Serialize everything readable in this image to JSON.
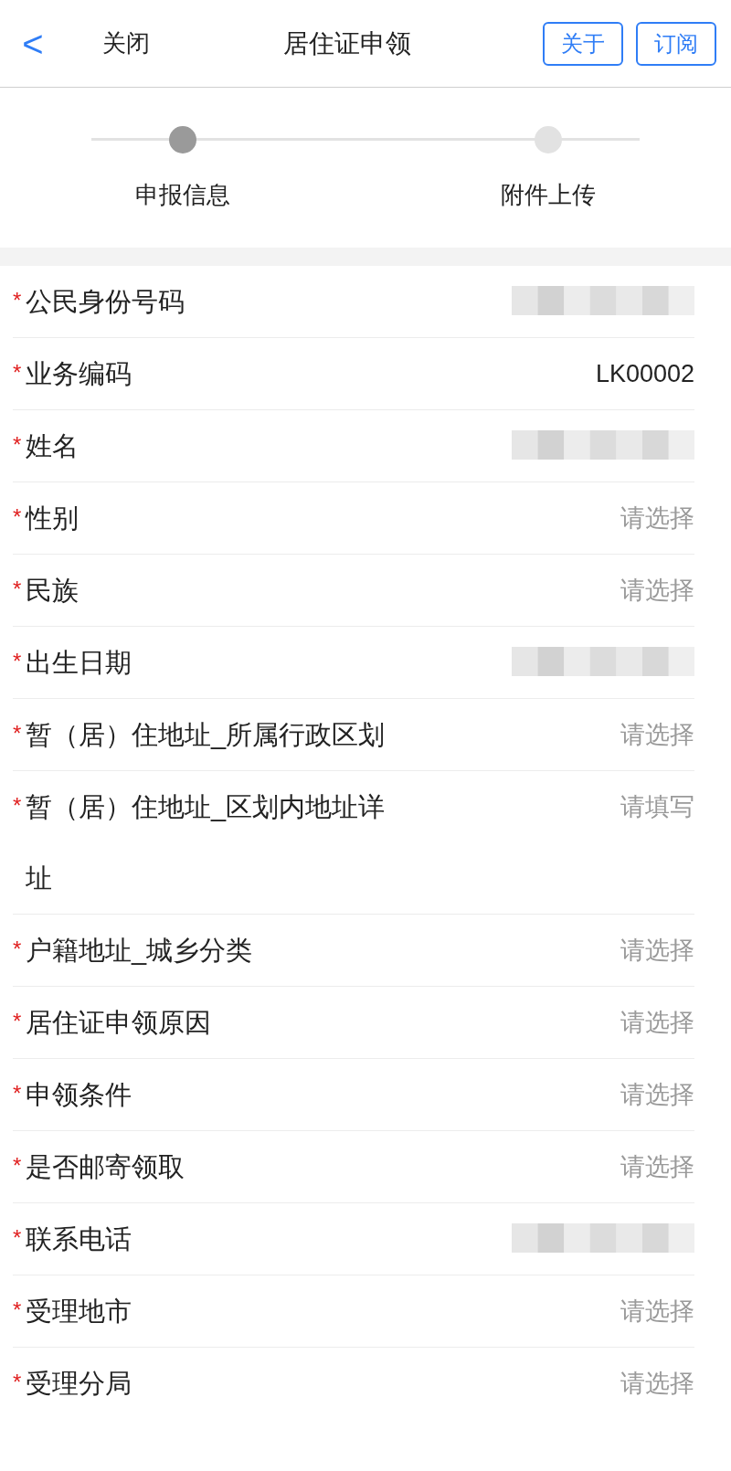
{
  "header": {
    "back": "<",
    "close": "关闭",
    "title": "居住证申领",
    "buttons": [
      "关于",
      "订阅"
    ]
  },
  "steps": [
    {
      "label": "申报信息",
      "active": true
    },
    {
      "label": "附件上传",
      "active": false
    }
  ],
  "fields": [
    {
      "required_mark": {
        "text": "*",
        "kind": "required"
      },
      "label": "公民身份号码",
      "kind": "redacted"
    },
    {
      "required_mark": {
        "text": "*",
        "kind": "required"
      },
      "label": "业务编码",
      "kind": "text",
      "value": "LK00002"
    },
    {
      "required_mark": {
        "text": "*",
        "kind": "required"
      },
      "label": "姓名",
      "kind": "redacted"
    },
    {
      "required_mark": {
        "text": "*",
        "kind": "required"
      },
      "label": "性别",
      "kind": "placeholder",
      "placeholder": "请选择"
    },
    {
      "required_mark": {
        "text": "*",
        "kind": "required"
      },
      "label": "民族",
      "kind": "placeholder",
      "placeholder": "请选择"
    },
    {
      "required_mark": {
        "text": "*",
        "kind": "required"
      },
      "label": "出生日期",
      "kind": "redacted"
    },
    {
      "required_mark": {
        "text": "*",
        "kind": "required"
      },
      "label": "暂（居）住地址_所属行政区划",
      "kind": "placeholder",
      "placeholder": "请选择"
    },
    {
      "required_mark": {
        "text": "*",
        "kind": "required"
      },
      "label": "暂（居）住地址_区划内地址详址",
      "kind": "placeholder",
      "placeholder": "请填写"
    },
    {
      "required_mark": {
        "text": "*",
        "kind": "required"
      },
      "label": "户籍地址_城乡分类",
      "kind": "placeholder",
      "placeholder": "请选择"
    },
    {
      "required_mark": {
        "text": "*",
        "kind": "required"
      },
      "label": "居住证申领原因",
      "kind": "placeholder",
      "placeholder": "请选择"
    },
    {
      "required_mark": {
        "text": "*",
        "kind": "required"
      },
      "label": "申领条件",
      "kind": "placeholder",
      "placeholder": "请选择"
    },
    {
      "required_mark": {
        "text": "*",
        "kind": "required"
      },
      "label": "是否邮寄领取",
      "kind": "placeholder",
      "placeholder": "请选择"
    },
    {
      "required_mark": {
        "text": "*",
        "kind": "required"
      },
      "label": "联系电话",
      "kind": "redacted"
    },
    {
      "required_mark": {
        "text": "*",
        "kind": "required"
      },
      "label": "受理地市",
      "kind": "placeholder",
      "placeholder": "请选择"
    },
    {
      "required_mark": {
        "text": "*",
        "kind": "required"
      },
      "label": "受理分局",
      "kind": "placeholder",
      "placeholder": "请选择"
    }
  ]
}
